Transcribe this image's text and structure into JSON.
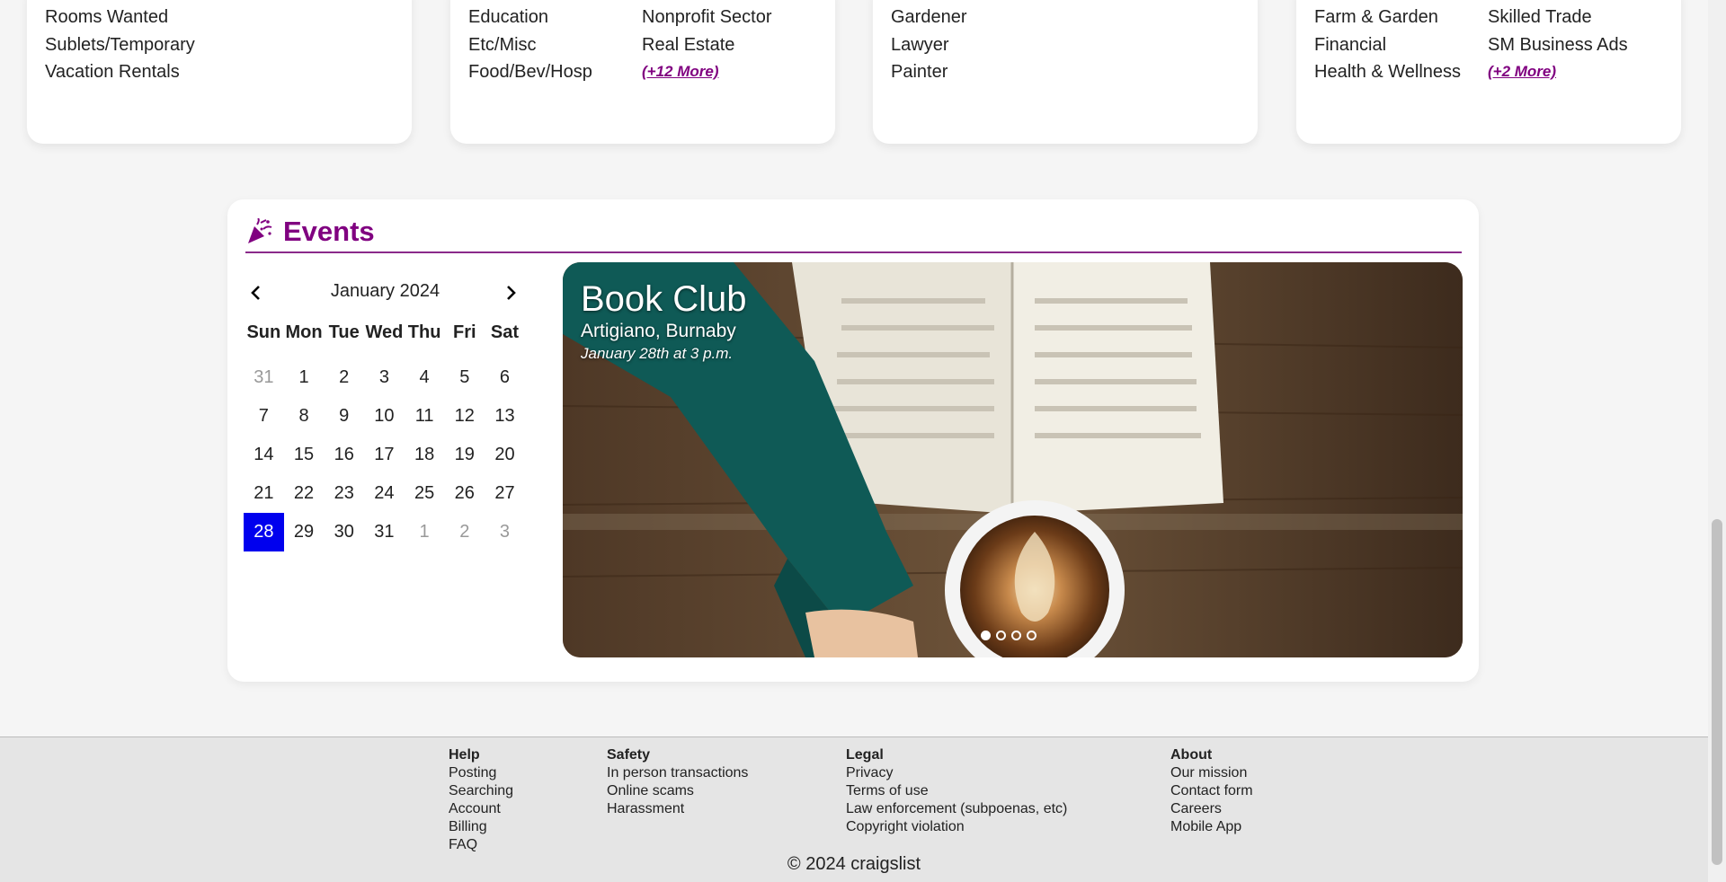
{
  "cards": [
    {
      "col1": [
        "Rooms Wanted",
        "Sublets/Temporary",
        "Vacation Rentals"
      ]
    },
    {
      "col1": [
        "Education",
        "Etc/Misc",
        "Food/Bev/Hosp"
      ],
      "col2": [
        "Nonprofit Sector",
        "Real Estate"
      ],
      "more": "(+12 More)"
    },
    {
      "col1": [
        "Gardener",
        "Lawyer",
        "Painter"
      ]
    },
    {
      "col1": [
        "Farm & Garden",
        "Financial",
        "Health & Wellness"
      ],
      "col2": [
        "Skilled Trade",
        "SM Business Ads"
      ],
      "more": "(+2 More)"
    }
  ],
  "events": {
    "title": "Events",
    "icon": "party-popper-icon",
    "accent": "#800080",
    "calendar": {
      "month": "January 2024",
      "weekdays": [
        "Sun",
        "Mon",
        "Tue",
        "Wed",
        "Thu",
        "Fri",
        "Sat"
      ],
      "days": [
        "31",
        "1",
        "2",
        "3",
        "4",
        "5",
        "6",
        "7",
        "8",
        "9",
        "10",
        "11",
        "12",
        "13",
        "14",
        "15",
        "16",
        "17",
        "18",
        "19",
        "20",
        "21",
        "22",
        "23",
        "24",
        "25",
        "26",
        "27",
        "28",
        "29",
        "30",
        "31",
        "1",
        "2",
        "3"
      ],
      "selected": "28",
      "selected_color": "#0000ee"
    },
    "slide": {
      "title": "Book Club",
      "venue": "Artigiano, Burnaby",
      "date": "January 28th at 3 p.m.",
      "slide_count": 4,
      "active_slide": 1
    }
  },
  "footer": {
    "help": {
      "heading": "Help",
      "links": [
        "Posting",
        "Searching",
        "Account",
        "Billing",
        "FAQ"
      ]
    },
    "safety": {
      "heading": "Safety",
      "links": [
        "In person transactions",
        "Online scams",
        "Harassment"
      ]
    },
    "legal": {
      "heading": "Legal",
      "links": [
        "Privacy",
        "Terms of use",
        "Law enforcement (subpoenas, etc)",
        "Copyright violation"
      ]
    },
    "about": {
      "heading": "About",
      "links": [
        "Our mission",
        "Contact form",
        "Careers",
        "Mobile App"
      ]
    },
    "copyright": "© 2024 craigslist"
  }
}
